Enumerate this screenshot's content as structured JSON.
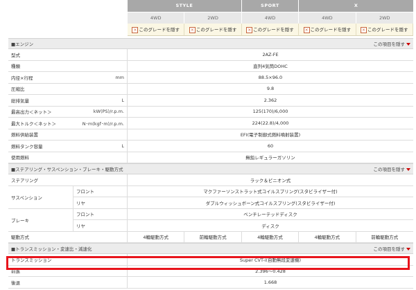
{
  "grades": {
    "groups": [
      {
        "name": "STYLE",
        "span": 2
      },
      {
        "name": "SPORT",
        "span": 1
      },
      {
        "name": "X",
        "span": 2
      }
    ],
    "drives": [
      "4WD",
      "2WD",
      "4WD",
      "4WD",
      "2WD"
    ],
    "hide_label": "このグレードを隠す"
  },
  "sections": {
    "engine": "■エンジン",
    "chassis": "■ステアリング・サスペンション・ブレーキ・駆動方式",
    "transmission": "■トランスミッション・変速比・減速化",
    "hide_item": "この項目を隠す"
  },
  "engine": [
    {
      "label": "型式",
      "unit": "",
      "value": "2AZ-FE"
    },
    {
      "label": "種類",
      "unit": "",
      "value": "直列4気筒DOHC"
    },
    {
      "label": "内径×行程",
      "unit": "mm",
      "value": "88.5×96.0"
    },
    {
      "label": "圧縮比",
      "unit": "",
      "value": "9.8"
    },
    {
      "label": "総排気量",
      "unit": "L",
      "value": "2.362"
    },
    {
      "label": "最高出力＜ネット＞",
      "unit": "kW(PS)/r.p.m.",
      "value": "125(170)/6,000"
    },
    {
      "label": "最大トルク＜ネット＞",
      "unit": "N･m(kgf･m)/r.p.m.",
      "value": "224(22.8)/4,000"
    },
    {
      "label": "燃料供給装置",
      "unit": "",
      "value": "EFI(電子制御式燃料噴射装置)"
    },
    {
      "label": "燃料タンク容量",
      "unit": "L",
      "value": "60"
    },
    {
      "label": "使用燃料",
      "unit": "",
      "value": "無鉛レギュラーガソリン"
    }
  ],
  "chassis": {
    "steering": {
      "label": "ステアリング",
      "value": "ラック＆ピニオン式"
    },
    "suspension": {
      "label": "サスペンション",
      "front_label": "フロント",
      "front_value": "マクファーソンストラット式コイルスプリング(スタビライザー付)",
      "rear_label": "リヤ",
      "rear_value": "ダブルウィッシュボーン式コイルスプリング(スタビライザー付)"
    },
    "brake": {
      "label": "ブレーキ",
      "front_label": "フロント",
      "front_value": "ベンチレーテッドディスク",
      "rear_label": "リヤ",
      "rear_value": "ディスク"
    },
    "drive": {
      "label": "駆動方式",
      "values": [
        "4輪駆動方式",
        "前輪駆動方式",
        "4輪駆動方式",
        "4輪駆動方式",
        "前輪駆動方式"
      ]
    }
  },
  "transmission": [
    {
      "label": "トランスミッション",
      "value": "Super CVT-i(自動無段変速機)"
    },
    {
      "label": "前進",
      "value": "2.396～0.428"
    },
    {
      "label": "後退",
      "value": "1.668"
    }
  ],
  "colors": {
    "highlight": "#e8141c",
    "header_bg": "#a8a8a8",
    "hide_row_bg": "#fbf7e4"
  }
}
